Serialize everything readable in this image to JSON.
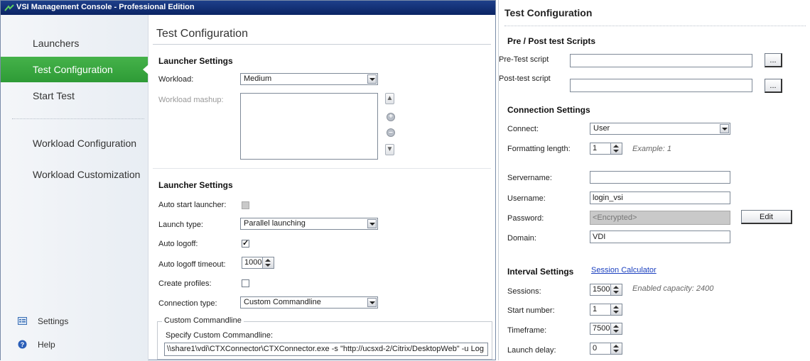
{
  "titlebar": {
    "title": "VSI Management Console - Professional Edition"
  },
  "sidebar": {
    "items": [
      {
        "label": "Launchers"
      },
      {
        "label": "Test Configuration"
      },
      {
        "label": "Start Test"
      },
      {
        "label": "Workload Configuration"
      },
      {
        "label": "Workload Customization"
      }
    ],
    "footer": [
      {
        "label": "Settings",
        "icon": "settings-icon"
      },
      {
        "label": "Help",
        "icon": "help-icon"
      }
    ]
  },
  "left": {
    "heading": "Test Configuration",
    "launcher_settings_1": {
      "title": "Launcher Settings",
      "workload_label": "Workload:",
      "workload_value": "Medium",
      "mashup_label": "Workload mashup:"
    },
    "launcher_settings_2": {
      "title": "Launcher Settings",
      "auto_start_label": "Auto start launcher:",
      "launch_type_label": "Launch type:",
      "launch_type_value": "Parallel launching",
      "auto_logoff_label": "Auto logoff:",
      "auto_logoff_timeout_label": "Auto logoff timeout:",
      "auto_logoff_timeout_value": "1000",
      "create_profiles_label": "Create profiles:",
      "connection_type_label": "Connection type:",
      "connection_type_value": "Custom Commandline"
    },
    "custom_commandline": {
      "legend": "Custom Commandline",
      "specify_label": "Specify Custom Commandline:",
      "value": "\\\\share1\\vdi\\CTXConnector\\CTXConnector.exe -s \"http://ucsxd-2/Citrix/DesktopWeb\" -u Log"
    }
  },
  "right": {
    "heading": "Test Configuration",
    "scripts": {
      "title": "Pre / Post test Scripts",
      "pre_label": "Pre-Test script",
      "post_label": "Post-test script",
      "browse_label": "..."
    },
    "connection": {
      "title": "Connection Settings",
      "connect_label": "Connect:",
      "connect_value": "User",
      "format_label": "Formatting length:",
      "format_value": "1",
      "format_example": "Example: 1",
      "servername_label": "Servername:",
      "servername_value": "",
      "username_label": "Username:",
      "username_value": "login_vsi",
      "password_label": "Password:",
      "password_value": "<Encrypted>",
      "edit_label": "Edit",
      "domain_label": "Domain:",
      "domain_value": "VDI"
    },
    "interval": {
      "title": "Interval Settings",
      "calculator_link": "Session Calculator",
      "sessions_label": "Sessions:",
      "sessions_value": "1500",
      "capacity_text": "Enabled capacity: 2400",
      "start_label": "Start number:",
      "start_value": "1",
      "timeframe_label": "Timeframe:",
      "timeframe_value": "7500",
      "delay_label": "Launch delay:",
      "delay_value": "0"
    }
  },
  "colors": {
    "titlebar": "#0b2464",
    "active_nav": "#3aa841",
    "link": "#1a3fbf"
  }
}
